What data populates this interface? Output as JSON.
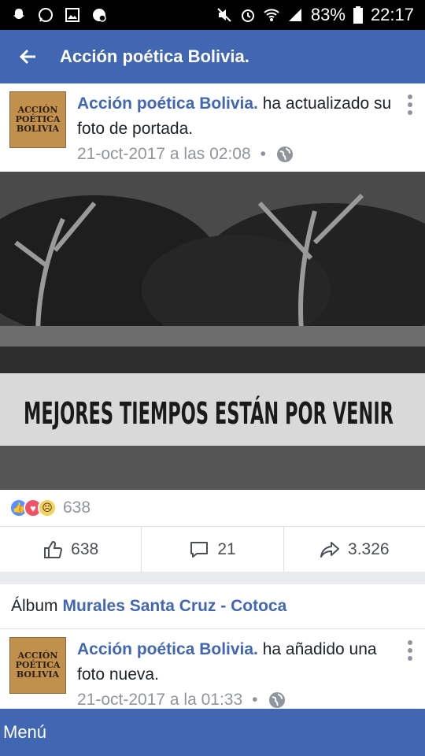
{
  "status_bar": {
    "battery": "83%",
    "time": "22:17",
    "left_icons": [
      "snapchat-icon",
      "whatsapp-icon",
      "gallery-icon",
      "facebook-icon"
    ],
    "right_icons": [
      "mute-icon",
      "alarm-icon",
      "wifi-icon",
      "signal-icon",
      "battery-icon"
    ]
  },
  "app_bar": {
    "title": "Acción poética Bolivia.",
    "background": "#4267b2"
  },
  "post1": {
    "page_name": "Acción poética Bolivia.",
    "action_text": " ha actualizado su foto de portada.",
    "timestamp": "21-oct-2017 a las 02:08",
    "separator": "•",
    "avatar_text": [
      "ACCIÓN",
      "POÉTICA",
      "BOLIVIA"
    ],
    "photo_text": "MEJORES TIEMPOS ESTÁN POR VENIR",
    "reaction_count": "638",
    "like_count": "638",
    "comment_count": "21",
    "share_count": "3.326"
  },
  "album": {
    "prefix": "Álbum",
    "name": "Murales Santa Cruz - Cotoca"
  },
  "post2": {
    "page_name": "Acción poética Bolivia.",
    "action_text": " ha añadido una foto nueva.",
    "timestamp": "21-oct-2017 a la 01:33",
    "separator": "•",
    "avatar_text": [
      "ACCIÓN",
      "POÉTICA",
      "BOLIVIA"
    ]
  },
  "bottom_bar": {
    "label": "Menú"
  }
}
